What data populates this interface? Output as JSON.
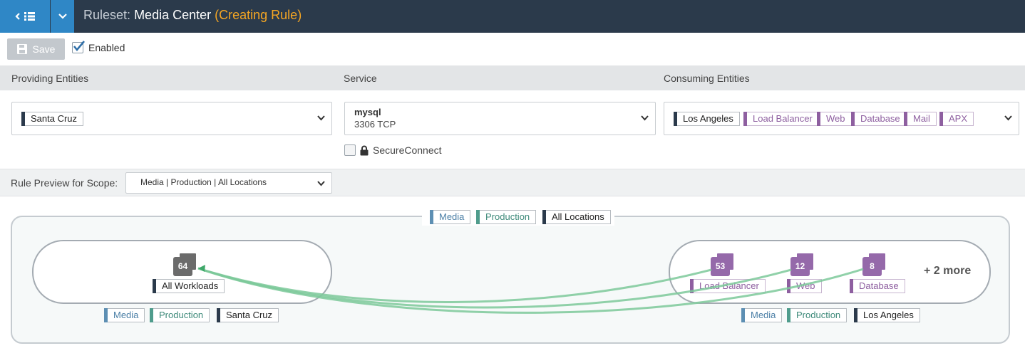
{
  "header": {
    "prefix": "Ruleset:",
    "name": "Media Center",
    "status": "(Creating Rule)"
  },
  "toolbar": {
    "save_label": "Save",
    "enabled_label": "Enabled",
    "enabled_checked": true
  },
  "columns": {
    "providing": "Providing Entities",
    "service": "Service",
    "consuming": "Consuming Entities"
  },
  "providing": {
    "labels": [
      "Santa Cruz"
    ]
  },
  "service": {
    "name": "mysql",
    "port": "3306 TCP"
  },
  "consuming": {
    "labels": [
      "Los Angeles",
      "Load Balancer",
      "Web",
      "Database",
      "Mail",
      "APX"
    ]
  },
  "secure_connect": {
    "label": "SecureConnect",
    "checked": false
  },
  "scope": {
    "label": "Rule Preview for Scope:",
    "value": "Media | Production | All Locations"
  },
  "graph": {
    "scope_labels": [
      "Media",
      "Production",
      "All Locations"
    ],
    "provider_group": {
      "workloads": [
        {
          "count": "64",
          "label": "All Workloads"
        }
      ],
      "labels": [
        "Media",
        "Production",
        "Santa Cruz"
      ]
    },
    "consumer_group": {
      "workloads": [
        {
          "count": "53",
          "label": "Load Balancer"
        },
        {
          "count": "12",
          "label": "Web"
        },
        {
          "count": "8",
          "label": "Database"
        }
      ],
      "more": "+ 2 more",
      "labels": [
        "Media",
        "Production",
        "Los Angeles"
      ]
    }
  },
  "colors": {
    "header_bg": "#2b3a4b",
    "accent_blue": "#2f87c6",
    "status_orange": "#f5a623",
    "role_purple": "#8e5fa0",
    "link_green": "#7cc99a"
  }
}
